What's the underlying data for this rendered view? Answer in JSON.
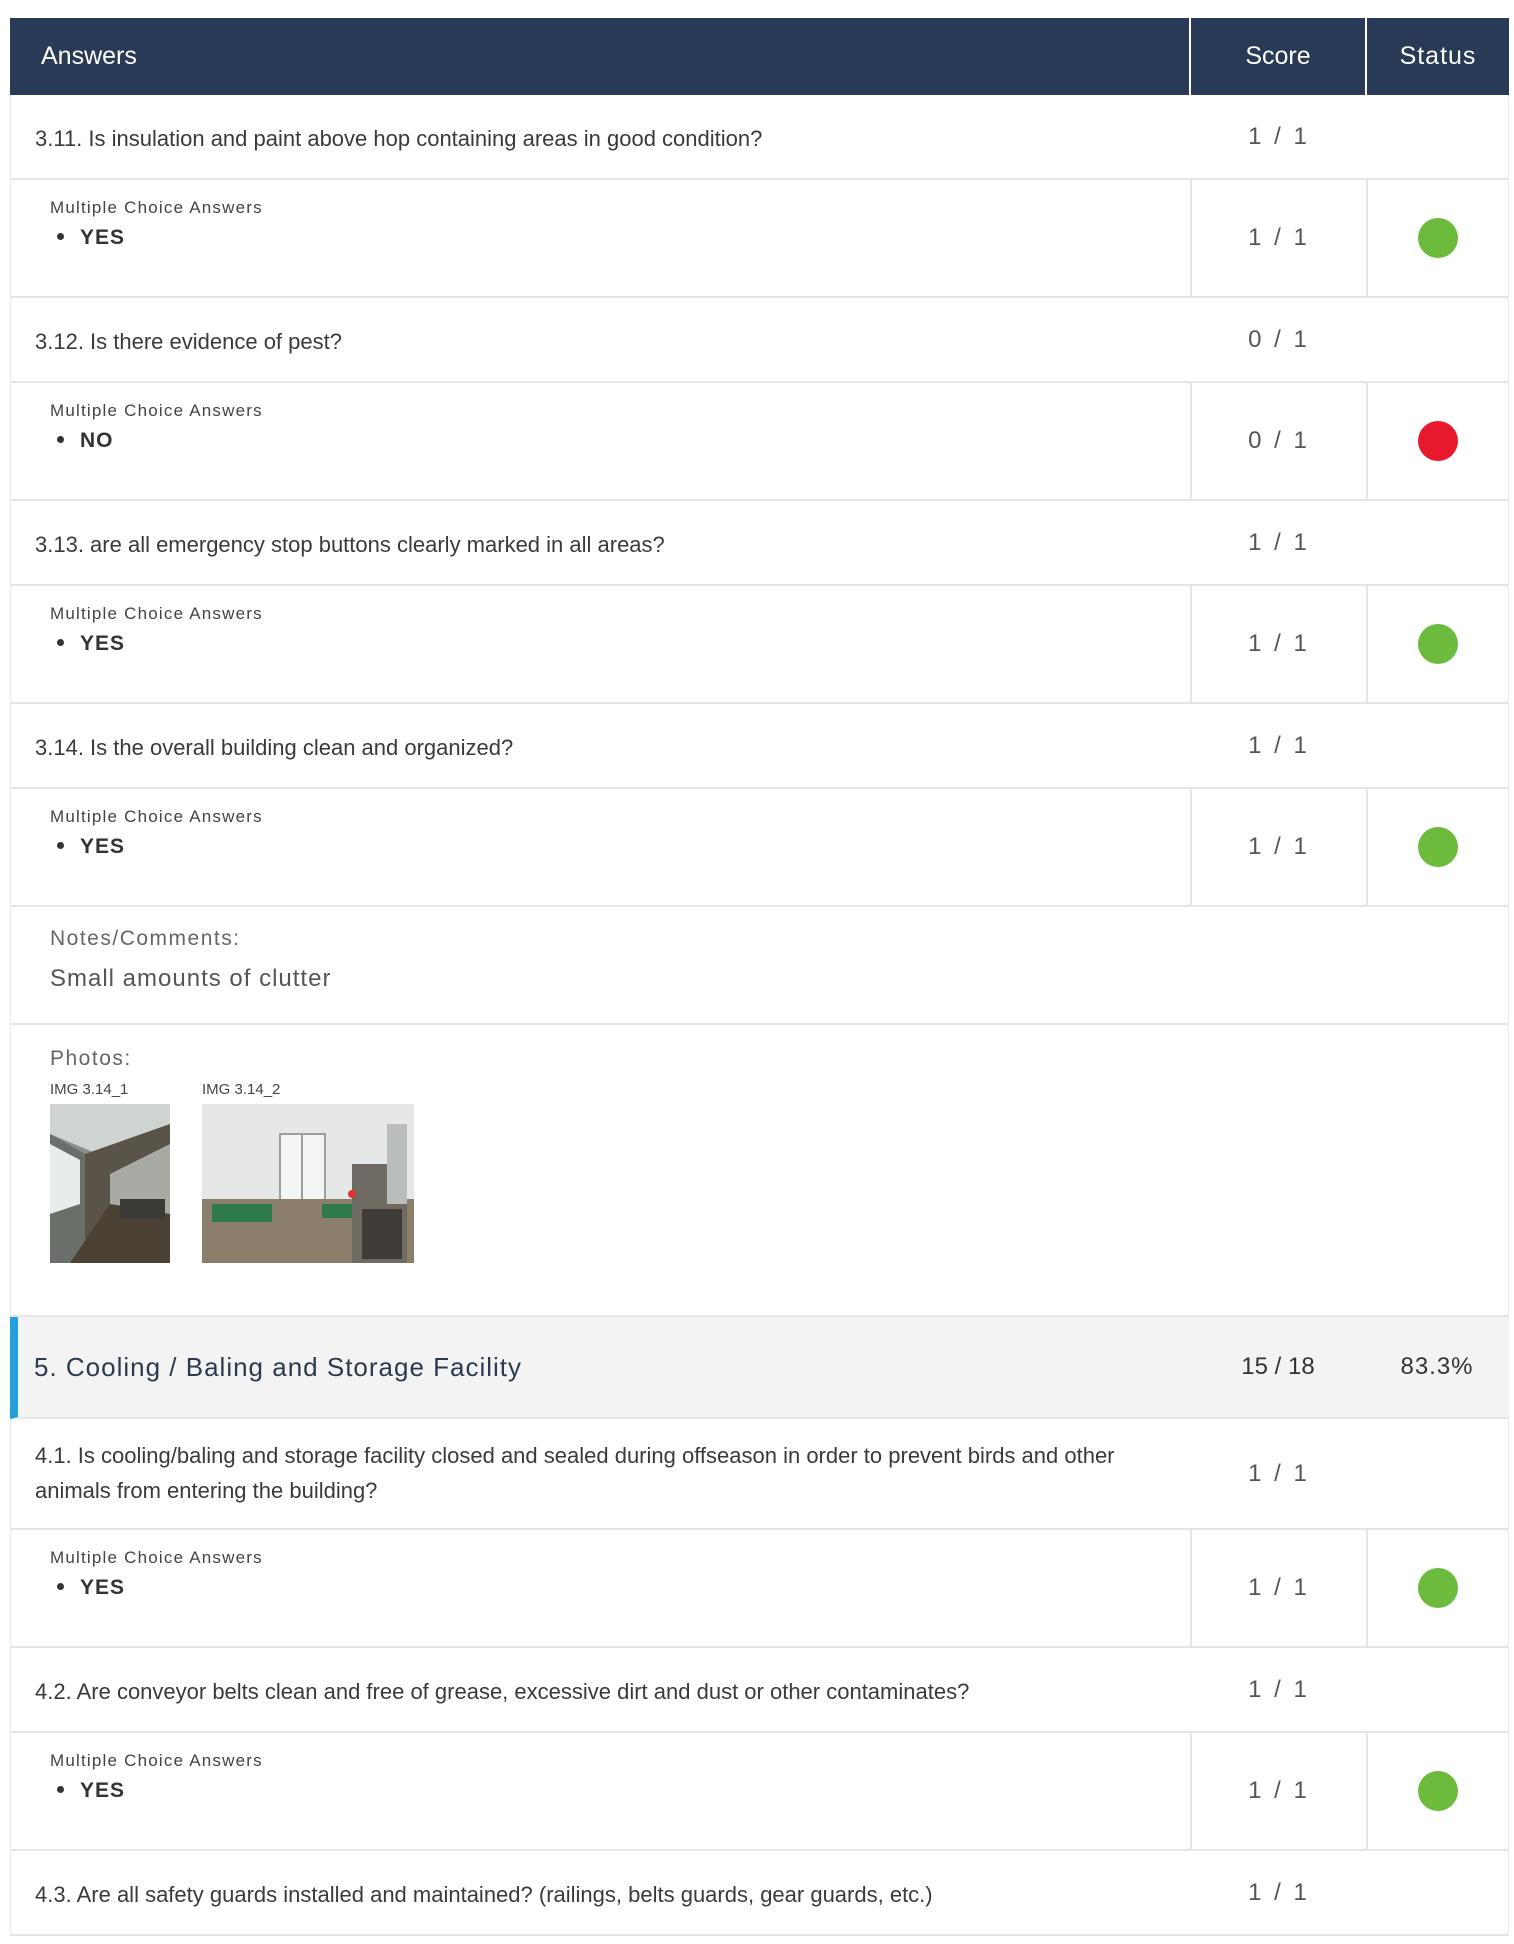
{
  "header": {
    "answers": "Answers",
    "score": "Score",
    "status": "Status"
  },
  "colors": {
    "header_bg": "#283a55",
    "pass": "#6cbb3c",
    "fail": "#e8192c",
    "section_accent": "#21a0dc"
  },
  "items": [
    {
      "question": "3.11. Is insulation and paint above hop containing areas in good condition?",
      "score": "1 / 1",
      "answer_label": "Multiple Choice Answers",
      "answer": "YES",
      "answer_score": "1 / 1",
      "status": "pass"
    },
    {
      "question": "3.12. Is there evidence of pest?",
      "score": "0 / 1",
      "answer_label": "Multiple Choice Answers",
      "answer": "NO",
      "answer_score": "0 / 1",
      "status": "fail"
    },
    {
      "question": "3.13. are all emergency stop buttons clearly marked in all areas?",
      "score": "1 / 1",
      "answer_label": "Multiple Choice Answers",
      "answer": "YES",
      "answer_score": "1 / 1",
      "status": "pass"
    },
    {
      "question": "3.14. Is the overall building clean and organized?",
      "score": "1 / 1",
      "answer_label": "Multiple Choice Answers",
      "answer": "YES",
      "answer_score": "1 / 1",
      "status": "pass"
    }
  ],
  "notes": {
    "label": "Notes/Comments:",
    "text": "Small amounts of clutter"
  },
  "photos": {
    "label": "Photos:",
    "items": [
      {
        "caption": "IMG 3.14_1"
      },
      {
        "caption": "IMG 3.14_2"
      }
    ]
  },
  "section": {
    "title": "5. Cooling / Baling and Storage Facility",
    "score": "15 / 18",
    "percent": "83.3%"
  },
  "section_items": [
    {
      "question": "4.1. Is cooling/baling and storage facility closed and sealed during offseason in order to prevent birds and other animals from entering the building?",
      "score": "1 / 1",
      "answer_label": "Multiple Choice Answers",
      "answer": "YES",
      "answer_score": "1 / 1",
      "status": "pass"
    },
    {
      "question": "4.2. Are conveyor belts clean and free of grease, excessive dirt and dust or other contaminates?",
      "score": "1 / 1",
      "answer_label": "Multiple Choice Answers",
      "answer": "YES",
      "answer_score": "1 / 1",
      "status": "pass"
    },
    {
      "question": "4.3. Are all safety guards installed and maintained? (railings, belts guards, gear guards, etc.)",
      "score": "1 / 1"
    }
  ]
}
